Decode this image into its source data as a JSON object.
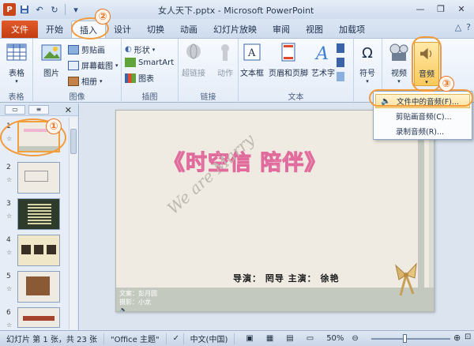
{
  "window": {
    "title": "女人天下.pptx - Microsoft PowerPoint",
    "app_icon": "P"
  },
  "tabs": {
    "file": "文件",
    "items": [
      "开始",
      "插入",
      "设计",
      "切换",
      "动画",
      "幻灯片放映",
      "审阅",
      "视图",
      "加载项"
    ]
  },
  "ribbon": {
    "groups": {
      "table": "表格",
      "image": "图像",
      "illustrations": "插图",
      "links": "链接",
      "text": "文本",
      "symbols": "",
      "media": ""
    },
    "buttons": {
      "table": "表格",
      "picture": "图片",
      "clipart": "剪贴画",
      "screenshot": "屏幕截图",
      "album": "相册",
      "shapes": "形状",
      "smartart": "SmartArt",
      "chart": "图表",
      "hyperlink": "超链接",
      "action": "动作",
      "textbox": "文本框",
      "header_footer": "页眉和页脚",
      "wordart": "艺术字",
      "symbol": "符号",
      "video": "视频",
      "audio": "音频"
    }
  },
  "dropdown": {
    "items": [
      "文件中的音频(F)...",
      "剪贴画音频(C)...",
      "录制音频(R)..."
    ]
  },
  "annotations": [
    "①",
    "②",
    "③"
  ],
  "thumbnails": {
    "numbers": [
      "1",
      "2",
      "3",
      "4",
      "5",
      "6"
    ],
    "star": "☆"
  },
  "slide": {
    "title": "《时空信  陪伴》",
    "script_text": "We are Marry",
    "credits": "导演： 罔导      主演： 徐艳",
    "small_credits_1": "文案：彭月圆",
    "small_credits_2": "摄影：小龙"
  },
  "statusbar": {
    "slide_info": "幻灯片 第 1 张，共 23 张",
    "theme": "\"Office 主题\"",
    "language": "中文(中国)",
    "zoom": "50%"
  },
  "colors": {
    "accent_orange": "#e8742a",
    "file_tab": "#c23d10",
    "title_pink": "#e06b9c"
  }
}
